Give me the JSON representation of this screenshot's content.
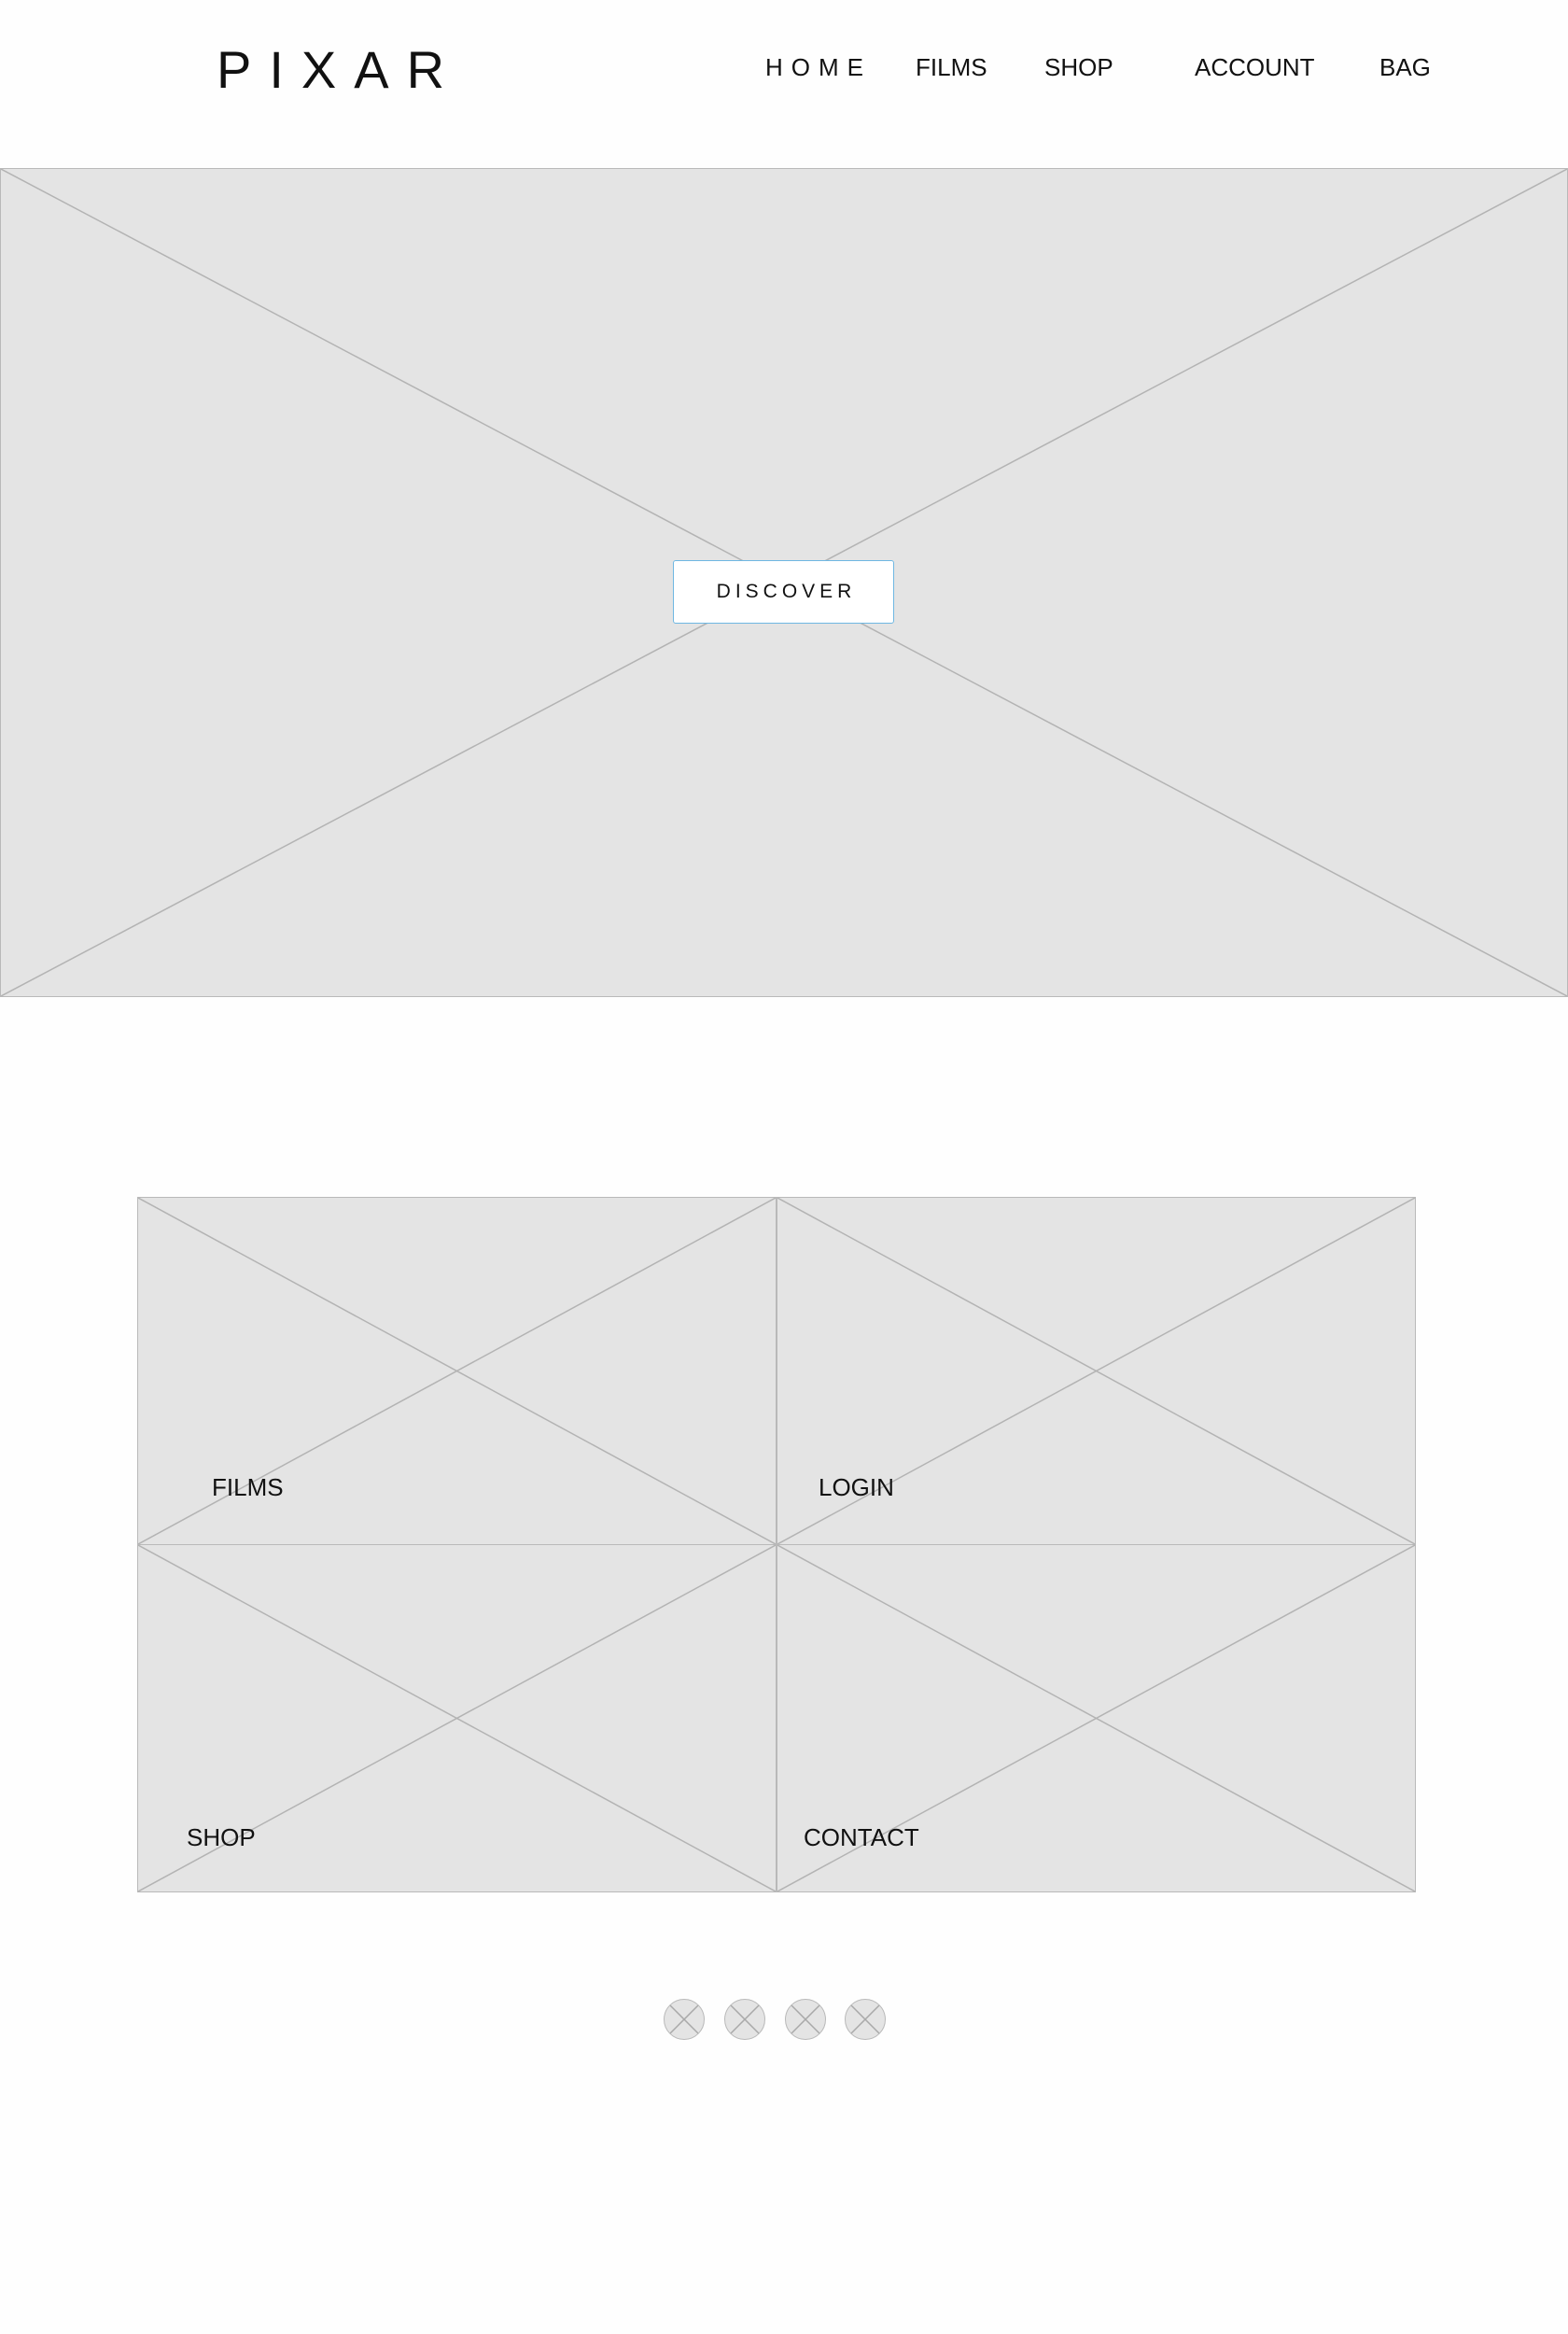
{
  "header": {
    "logo": "PIXAR",
    "nav": {
      "home": "HOME",
      "films": "FILMS",
      "shop": "SHOP",
      "account": "ACCOUNT",
      "bag": "BAG"
    }
  },
  "hero": {
    "button_label": "DISCOVER"
  },
  "tiles": {
    "films": "FILMS",
    "login": "LOGIN",
    "shop": "SHOP",
    "contact": "CONTACT"
  },
  "social": {
    "icons": [
      "image-placeholder-icon",
      "image-placeholder-icon",
      "image-placeholder-icon",
      "image-placeholder-icon"
    ]
  },
  "colors": {
    "placeholder_fill": "#e4e4e4",
    "placeholder_stroke": "#b9b9b9",
    "button_border": "#6fb7e2",
    "text": "#111111"
  }
}
